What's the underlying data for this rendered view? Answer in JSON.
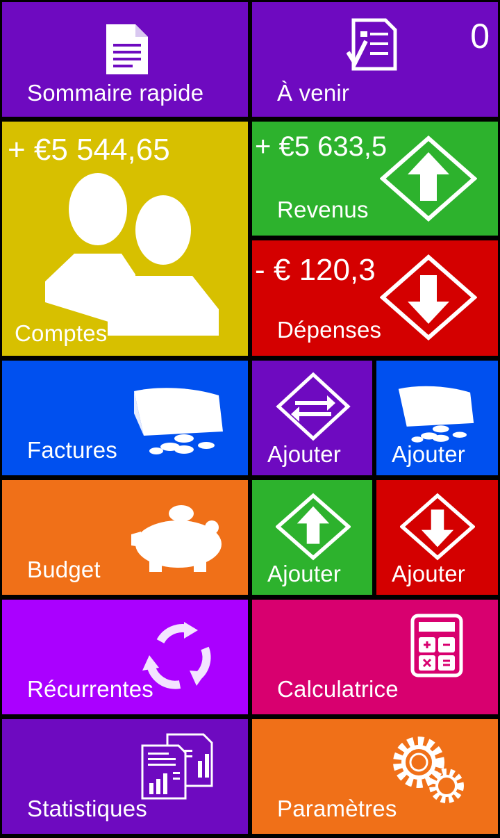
{
  "tiles": {
    "quick_summary": {
      "label": "Sommaire rapide",
      "icon": "document-icon",
      "color": "#6e0ac0"
    },
    "upcoming": {
      "label": "À venir",
      "count": "0",
      "icon": "checklist-icon",
      "color": "#6e0ac0"
    },
    "accounts": {
      "label": "Comptes",
      "amount": "+ €5 544,65",
      "icon": "people-icon",
      "color": "#d7c000"
    },
    "income": {
      "label": "Revenus",
      "amount": "+ €5 633,5",
      "icon": "arrow-up-diamond-icon",
      "color": "#2db22d"
    },
    "expenses": {
      "label": "Dépenses",
      "amount": "- € 120,3",
      "icon": "arrow-down-diamond-icon",
      "color": "#d40000"
    },
    "bills": {
      "label": "Factures",
      "icon": "wallet-coins-icon",
      "color": "#0050ef"
    },
    "add_transfer": {
      "label": "Ajouter",
      "icon": "transfer-diamond-icon",
      "color": "#6e0ac0"
    },
    "add_bill": {
      "label": "Ajouter",
      "icon": "wallet-coins-icon",
      "color": "#0050ef"
    },
    "budget": {
      "label": "Budget",
      "icon": "piggy-bank-icon",
      "color": "#f07018"
    },
    "add_income": {
      "label": "Ajouter",
      "icon": "arrow-up-diamond-icon",
      "color": "#2db22d"
    },
    "add_expense": {
      "label": "Ajouter",
      "icon": "arrow-down-diamond-icon",
      "color": "#d40000"
    },
    "recurring": {
      "label": "Récurrentes",
      "icon": "cycle-arrows-icon",
      "color": "#aa00ff"
    },
    "calculator": {
      "label": "Calculatrice",
      "icon": "calculator-icon",
      "color": "#d8006f"
    },
    "statistics": {
      "label": "Statistiques",
      "icon": "report-chart-icon",
      "color": "#6e0ac0"
    },
    "settings": {
      "label": "Paramètres",
      "icon": "gears-icon",
      "color": "#f07018"
    }
  }
}
